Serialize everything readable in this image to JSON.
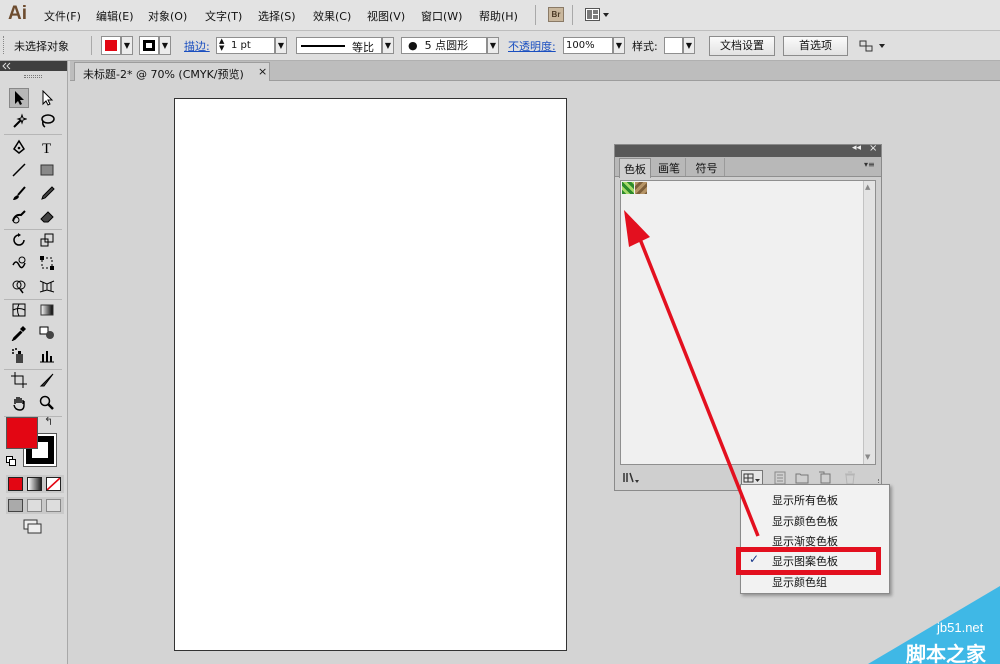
{
  "app": {
    "logo": "Ai",
    "br_label": "Br"
  },
  "menu": [
    "文件(F)",
    "编辑(E)",
    "对象(O)",
    "文字(T)",
    "选择(S)",
    "效果(C)",
    "视图(V)",
    "窗口(W)",
    "帮助(H)"
  ],
  "control_bar": {
    "selection_status": "未选择对象",
    "fill_color": "#e30613",
    "stroke_label": "描边:",
    "stroke_weight": "1 pt",
    "stroke_profile": "等比",
    "brush": "5 点圆形",
    "opacity_label": "不透明度:",
    "opacity": "100%",
    "style_label": "样式:",
    "doc_setup": "文档设置",
    "preferences": "首选项"
  },
  "document": {
    "tab_title": "未标题-2* @ 70% (CMYK/预览)"
  },
  "tools": {
    "fill_color": "#e30613",
    "stroke_color": "#000000"
  },
  "swatches_panel": {
    "tabs": [
      "色板",
      "画笔",
      "符号"
    ],
    "active_tab": "色板"
  },
  "context_menu": {
    "items": [
      "显示所有色板",
      "显示颜色色板",
      "显示渐变色板",
      "显示图案色板",
      "显示颜色组"
    ],
    "checked_index": 3
  },
  "annotation": {
    "highlight_color": "#e3101f"
  },
  "watermark": {
    "line1": "jb51.net",
    "line2": "脚本之家"
  }
}
